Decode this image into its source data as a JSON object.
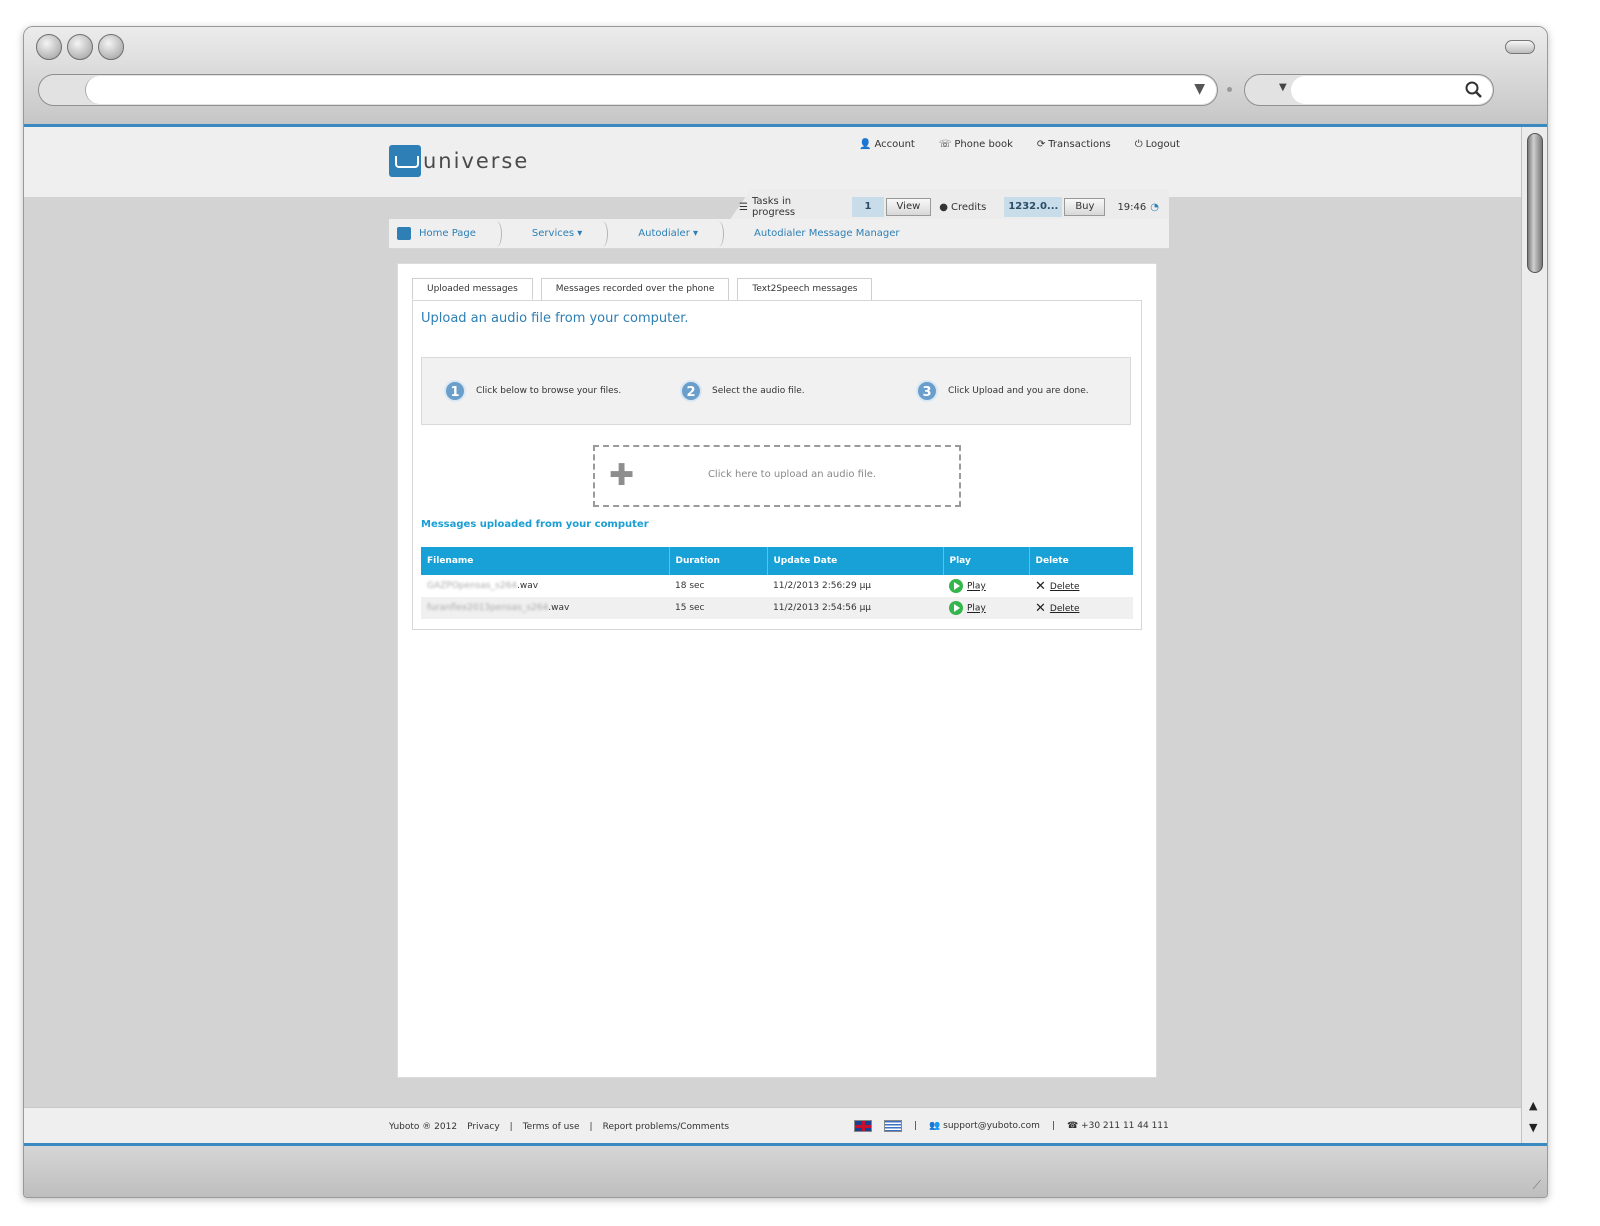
{
  "brand": {
    "logo_text": "universe",
    "accent": "#2d7fb5"
  },
  "top_links": [
    {
      "icon": "user-icon",
      "glyph": "👤",
      "label": "Account"
    },
    {
      "icon": "phonebook-icon",
      "glyph": "☏",
      "label": "Phone book"
    },
    {
      "icon": "refresh-icon",
      "glyph": "⟳",
      "label": "Transactions"
    },
    {
      "icon": "power-icon",
      "glyph": "⏻",
      "label": "Logout"
    }
  ],
  "status": {
    "tasks_label": "Tasks in progress",
    "tasks_count": "1",
    "view_label": "View",
    "credits_label": "Credits",
    "credits_value": "1232.0...",
    "buy_label": "Buy",
    "time": "19:46"
  },
  "nav": {
    "home": "Home Page",
    "services": "Services ▾",
    "autodialer": "Autodialer ▾",
    "current": "Autodialer Message Manager"
  },
  "subtabs": [
    "Uploaded messages",
    "Messages recorded over the phone",
    "Text2Speech messages"
  ],
  "upload": {
    "title": "Upload an audio file from your computer.",
    "steps": [
      {
        "num": "1",
        "text": "Click below to browse your files."
      },
      {
        "num": "2",
        "text": "Select the audio file."
      },
      {
        "num": "3",
        "text": "Click Upload and you are done."
      }
    ],
    "dropzone_text": "Click here to upload an audio file."
  },
  "messages": {
    "heading": "Messages uploaded from your computer",
    "columns": [
      "Filename",
      "Duration",
      "Update Date",
      "Play",
      "Delete"
    ],
    "rows": [
      {
        "filename_blur": "GAZPOpensas_s264",
        "filename_ext": ".wav",
        "duration": "18 sec",
        "date": "11/2/2013 2:56:29 μμ",
        "play": "Play",
        "delete": "Delete"
      },
      {
        "filename_blur": "furanflex2013pensas_s264",
        "filename_ext": ".wav",
        "duration": "15 sec",
        "date": "11/2/2013 2:54:56 μμ",
        "play": "Play",
        "delete": "Delete"
      }
    ]
  },
  "footer": {
    "copyright": "Yuboto ® 2012",
    "privacy": "Privacy",
    "terms": "Terms of use",
    "report": "Report problems/Comments",
    "email": "support@yuboto.com",
    "phone": "+30 211 11 44 111"
  }
}
